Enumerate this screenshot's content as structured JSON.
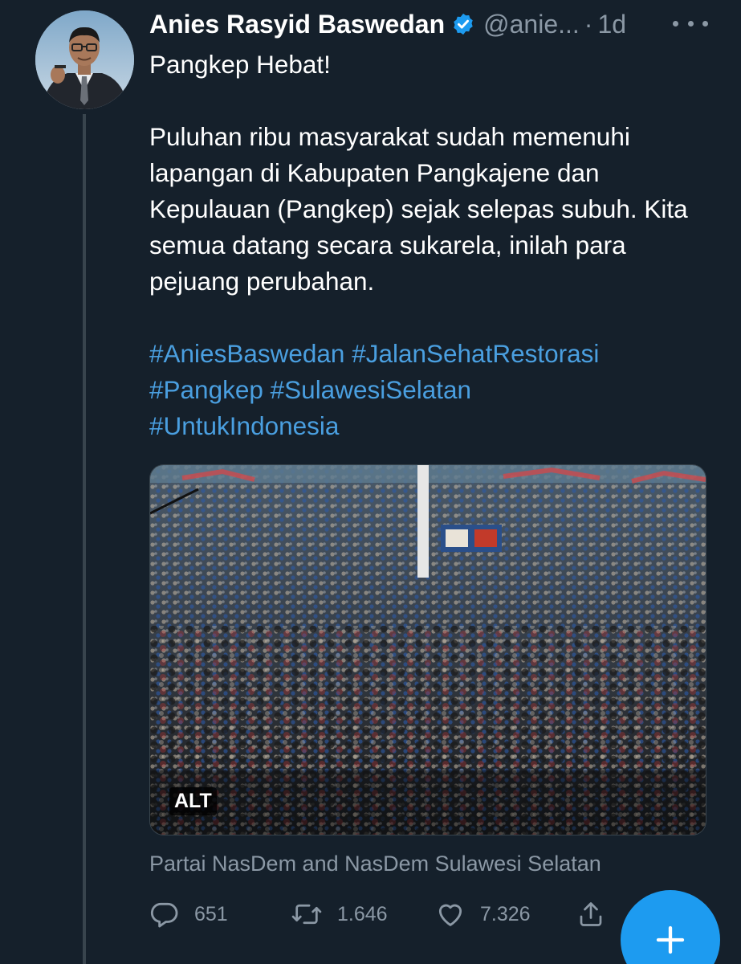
{
  "author": {
    "name": "Anies Rasyid Baswedan",
    "handle": "@anie...",
    "separator": "·",
    "time": "1d"
  },
  "tweet": {
    "line1": "Pangkep Hebat!",
    "paragraph": "Puluhan ribu masyarakat sudah memenuhi lapangan di Kabupaten Pangkajene dan Kepulauan (Pangkep) sejak selepas subuh. Kita semua datang secara sukarela, inilah para pejuang perubahan.",
    "hashtags": [
      "#AniesBaswedan",
      "#JalanSehatRestorasi",
      "#Pangkep",
      "#SulawesiSelatan",
      "#UntukIndonesia"
    ]
  },
  "media": {
    "alt_label": "ALT"
  },
  "tagged": "Partai NasDem and NasDem Sulawesi Selatan",
  "actions": {
    "replies": "651",
    "retweets": "1.646",
    "likes": "7.326"
  },
  "colors": {
    "background": "#15202b",
    "accent": "#1d9bf0",
    "muted": "#8b98a5"
  }
}
